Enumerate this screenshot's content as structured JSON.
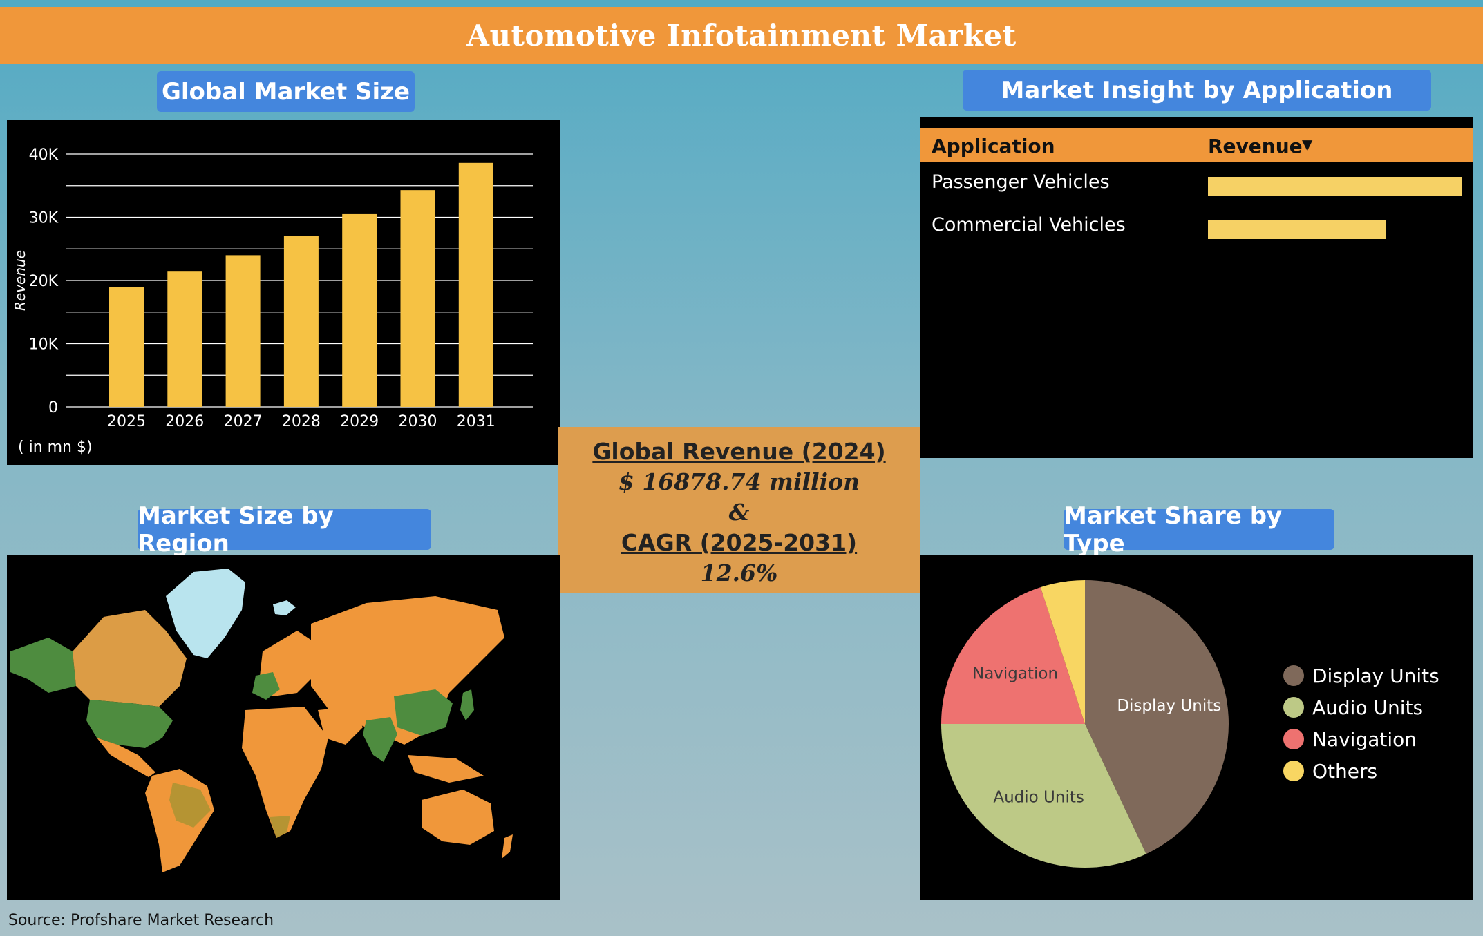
{
  "title": "Automotive Infotainment Market",
  "source": "Source: Profshare Market Research",
  "headers": {
    "global_market_size": "Global Market Size",
    "market_insight": "Market Insight by Application",
    "market_region": "Market Size by Region",
    "market_share_type": "Market Share by Type"
  },
  "center": {
    "revenue_label": "Global Revenue (2024)",
    "revenue_value": "$ 16878.74 million",
    "amp": "&",
    "cagr_label": "CAGR (2025-2031)",
    "cagr_value": "12.6%"
  },
  "application_table": {
    "col_application": "Application",
    "col_revenue": "Revenue",
    "sort_icon": "caret-down-icon"
  },
  "colors": {
    "bar": "#f6c244",
    "header_orange": "#f0973a",
    "pill_blue": "#4486dd",
    "map_land": "#f0973a",
    "map_highlight": "#4e8c3f",
    "map_ice": "#b9e4ee"
  },
  "chart_data": [
    {
      "type": "bar",
      "categories": [
        "2025",
        "2026",
        "2027",
        "2028",
        "2029",
        "2030",
        "2031"
      ],
      "values": [
        19000,
        21400,
        24000,
        27000,
        30500,
        34300,
        38600
      ],
      "ylabel": "Revenue",
      "unit_note": "( in mn $)",
      "ylim": [
        0,
        40000
      ],
      "ticks": [
        "0",
        "10K",
        "20K",
        "30K",
        "40K"
      ],
      "tick_values": [
        0,
        10000,
        20000,
        30000,
        40000
      ],
      "grid": true
    },
    {
      "type": "bar",
      "orientation": "horizontal",
      "categories": [
        "Passenger Vehicles",
        "Commercial Vehicles"
      ],
      "values": [
        100,
        70
      ]
    },
    {
      "type": "pie",
      "labels": [
        "Display Units",
        "Audio Units",
        "Navigation",
        "Others"
      ],
      "values": [
        43,
        32,
        20,
        5
      ],
      "colors": [
        "#7f695a",
        "#bdc986",
        "#ee7270",
        "#f8d662"
      ],
      "legend": "right"
    }
  ]
}
